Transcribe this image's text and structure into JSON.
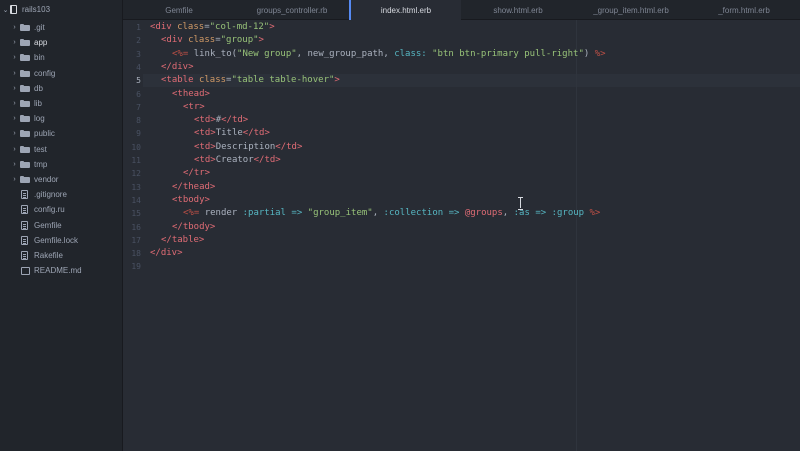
{
  "project": {
    "name": "rails103"
  },
  "tree": [
    {
      "label": ".git",
      "kind": "folder",
      "expanded": false
    },
    {
      "label": "app",
      "kind": "folder",
      "expanded": false,
      "selected": true
    },
    {
      "label": "bin",
      "kind": "folder",
      "expanded": false
    },
    {
      "label": "config",
      "kind": "folder",
      "expanded": false
    },
    {
      "label": "db",
      "kind": "folder",
      "expanded": false
    },
    {
      "label": "lib",
      "kind": "folder",
      "expanded": false
    },
    {
      "label": "log",
      "kind": "folder",
      "expanded": false
    },
    {
      "label": "public",
      "kind": "folder",
      "expanded": false
    },
    {
      "label": "test",
      "kind": "folder",
      "expanded": false
    },
    {
      "label": "tmp",
      "kind": "folder",
      "expanded": false
    },
    {
      "label": "vendor",
      "kind": "folder",
      "expanded": false
    },
    {
      "label": ".gitignore",
      "kind": "file"
    },
    {
      "label": "config.ru",
      "kind": "file"
    },
    {
      "label": "Gemfile",
      "kind": "file"
    },
    {
      "label": "Gemfile.lock",
      "kind": "file"
    },
    {
      "label": "Rakefile",
      "kind": "file"
    },
    {
      "label": "README.md",
      "kind": "book"
    }
  ],
  "tabs": [
    {
      "label": "Gemfile",
      "active": false
    },
    {
      "label": "groups_controller.rb",
      "active": false
    },
    {
      "label": "index.html.erb",
      "active": true
    },
    {
      "label": "show.html.erb",
      "active": false
    },
    {
      "label": "_group_item.html.erb",
      "active": false
    },
    {
      "label": "_form.html.erb",
      "active": false
    }
  ],
  "editor": {
    "current_line": 5,
    "lines": [
      {
        "n": "1",
        "indent": 0,
        "tokens": [
          [
            "tag",
            "<div "
          ],
          [
            "attr",
            "class"
          ],
          [
            "plain",
            "="
          ],
          [
            "str",
            "\"col-md-12\""
          ],
          [
            "tag",
            ">"
          ]
        ]
      },
      {
        "n": "2",
        "indent": 1,
        "tokens": [
          [
            "tag",
            "<div "
          ],
          [
            "attr",
            "class"
          ],
          [
            "plain",
            "="
          ],
          [
            "str",
            "\"group\""
          ],
          [
            "tag",
            ">"
          ]
        ]
      },
      {
        "n": "3",
        "indent": 2,
        "tokens": [
          [
            "erb",
            "<%= "
          ],
          [
            "plain",
            "link_to("
          ],
          [
            "str",
            "\"New group\""
          ],
          [
            "plain",
            ", new_group_path, "
          ],
          [
            "sym",
            "class:"
          ],
          [
            "plain",
            " "
          ],
          [
            "str",
            "\"btn btn-primary pull-right\""
          ],
          [
            "plain",
            ") "
          ],
          [
            "erb",
            "%>"
          ]
        ]
      },
      {
        "n": "4",
        "indent": 1,
        "tokens": [
          [
            "tag",
            "</div>"
          ]
        ]
      },
      {
        "n": "5",
        "indent": 1,
        "tokens": [
          [
            "tag",
            "<table "
          ],
          [
            "attr",
            "class"
          ],
          [
            "plain",
            "="
          ],
          [
            "str",
            "\"table table-hover\""
          ],
          [
            "tag",
            ">"
          ]
        ]
      },
      {
        "n": "6",
        "indent": 2,
        "tokens": [
          [
            "tag",
            "<thead>"
          ]
        ]
      },
      {
        "n": "7",
        "indent": 3,
        "tokens": [
          [
            "tag",
            "<tr>"
          ]
        ]
      },
      {
        "n": "8",
        "indent": 4,
        "tokens": [
          [
            "tag",
            "<td>"
          ],
          [
            "plain",
            "#"
          ],
          [
            "tag",
            "</td>"
          ]
        ]
      },
      {
        "n": "9",
        "indent": 4,
        "tokens": [
          [
            "tag",
            "<td>"
          ],
          [
            "plain",
            "Title"
          ],
          [
            "tag",
            "</td>"
          ]
        ]
      },
      {
        "n": "10",
        "indent": 4,
        "tokens": [
          [
            "tag",
            "<td>"
          ],
          [
            "plain",
            "Description"
          ],
          [
            "tag",
            "</td>"
          ]
        ]
      },
      {
        "n": "11",
        "indent": 4,
        "tokens": [
          [
            "tag",
            "<td>"
          ],
          [
            "plain",
            "Creator"
          ],
          [
            "tag",
            "</td>"
          ]
        ]
      },
      {
        "n": "12",
        "indent": 3,
        "tokens": [
          [
            "tag",
            "</tr>"
          ]
        ]
      },
      {
        "n": "13",
        "indent": 2,
        "tokens": [
          [
            "tag",
            "</thead>"
          ]
        ]
      },
      {
        "n": "14",
        "indent": 2,
        "tokens": [
          [
            "tag",
            "<tbody>"
          ]
        ]
      },
      {
        "n": "15",
        "indent": 3,
        "tokens": [
          [
            "erb",
            "<%= "
          ],
          [
            "plain",
            "render "
          ],
          [
            "sym",
            ":partial"
          ],
          [
            "plain",
            " "
          ],
          [
            "op",
            "=>"
          ],
          [
            "plain",
            " "
          ],
          [
            "str",
            "\"group_item\""
          ],
          [
            "plain",
            ", "
          ],
          [
            "sym",
            ":collection"
          ],
          [
            "plain",
            " "
          ],
          [
            "op",
            "=>"
          ],
          [
            "plain",
            " "
          ],
          [
            "ivar",
            "@groups"
          ],
          [
            "plain",
            ", "
          ],
          [
            "sym",
            ":as"
          ],
          [
            "plain",
            " "
          ],
          [
            "op",
            "=>"
          ],
          [
            "plain",
            " "
          ],
          [
            "sym",
            ":group"
          ],
          [
            "plain",
            " "
          ],
          [
            "erb",
            "%>"
          ]
        ]
      },
      {
        "n": "16",
        "indent": 2,
        "tokens": [
          [
            "tag",
            "</tbody>"
          ]
        ]
      },
      {
        "n": "17",
        "indent": 1,
        "tokens": [
          [
            "tag",
            "</table>"
          ]
        ]
      },
      {
        "n": "18",
        "indent": 0,
        "tokens": [
          [
            "tag",
            "</div>"
          ]
        ]
      },
      {
        "n": "19",
        "indent": 0,
        "tokens": []
      }
    ]
  }
}
